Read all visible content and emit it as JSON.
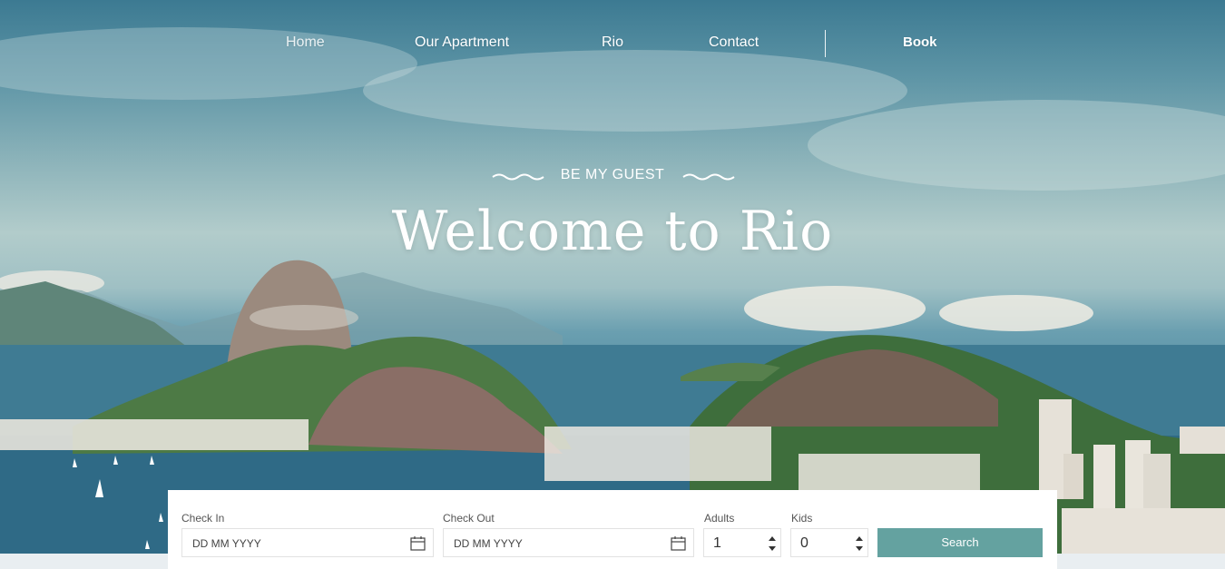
{
  "nav": {
    "home": "Home",
    "apartment": "Our Apartment",
    "rio": "Rio",
    "contact": "Contact",
    "book": "Book"
  },
  "hero": {
    "tagline": "BE MY GUEST",
    "headline": "Welcome to Rio"
  },
  "booking": {
    "check_in_label": "Check In",
    "check_in_placeholder": "DD MM YYYY",
    "check_out_label": "Check Out",
    "check_out_placeholder": "DD MM YYYY",
    "adults_label": "Adults",
    "adults_value": "1",
    "kids_label": "Kids",
    "kids_value": "0",
    "search_label": "Search"
  },
  "colors": {
    "accent": "#64a2a0",
    "text_light": "#ffffff"
  },
  "icons": {
    "calendar": "calendar-icon",
    "spinner": "spinner-arrows-icon",
    "wave": "wave-ornament-icon"
  }
}
